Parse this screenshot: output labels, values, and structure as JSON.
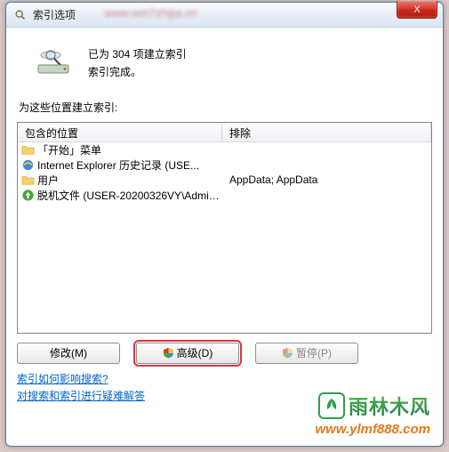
{
  "window": {
    "title": "索引选项",
    "close_x": "X",
    "blur_url": "www.win7zhijia.cn"
  },
  "status": {
    "line1": "已为 304 项建立索引",
    "line2": "索引完成。"
  },
  "section_label": "为这些位置建立索引:",
  "headers": {
    "included": "包含的位置",
    "excluded": "排除"
  },
  "rows": [
    {
      "icon": "folder",
      "text": "「开始」菜单",
      "exclude": ""
    },
    {
      "icon": "ie",
      "text": "Internet Explorer 历史记录 (USE...",
      "exclude": ""
    },
    {
      "icon": "folder",
      "text": "用户",
      "exclude": "AppData; AppData"
    },
    {
      "icon": "offline",
      "text": "脱机文件 (USER-20200326VY\\Admin...",
      "exclude": ""
    }
  ],
  "buttons": {
    "modify": "修改(M)",
    "advanced": "高级(D)",
    "pause": "暂停(P)"
  },
  "links": {
    "l1": "索引如何影响搜索?",
    "l2": "对搜索和索引进行疑难解答"
  },
  "watermark": {
    "brand": "雨林木风",
    "url": "www.ylmf888.com"
  }
}
